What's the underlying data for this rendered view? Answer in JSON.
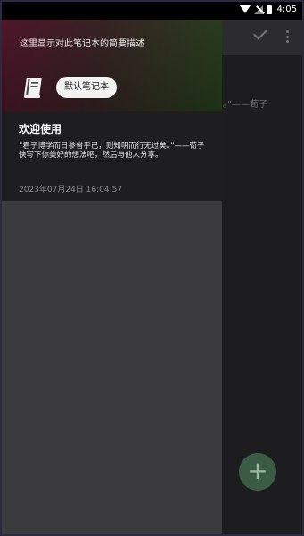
{
  "status_bar": {
    "time": "4:05"
  },
  "toolbar": {
    "check_icon": "check-icon",
    "more_icon": "more-vert-icon"
  },
  "background": {
    "note_snippet": "。”——荀子"
  },
  "drawer": {
    "description": "这里显示对此笔记本的简要描述",
    "notebook_icon": "book-icon",
    "notebook_name": "默认笔记本"
  },
  "notes": [
    {
      "title": "欢迎使用",
      "body": "“君子博学而日参省乎己，则知明而行无过矣。”——荀子 快写下你美好的想法吧，然后与他人分享。",
      "date": "2023年07月24日 16:04:57"
    }
  ],
  "fab": {
    "icon": "add-icon",
    "label": "+"
  },
  "colors": {
    "fab": "#3a5c45",
    "drawer": "#3b3b3d",
    "card": "#1e1e20"
  }
}
